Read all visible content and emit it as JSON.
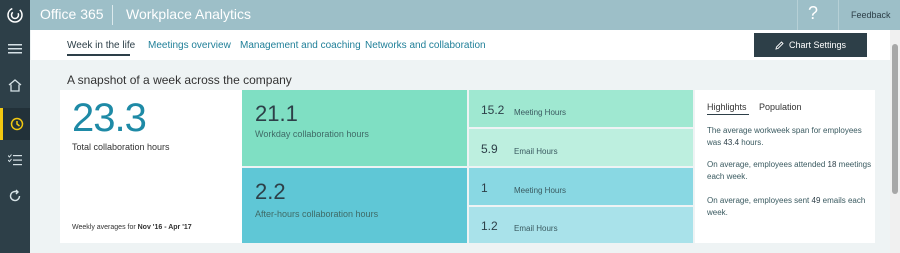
{
  "header": {
    "app_name": "Office 365",
    "product_name": "Workplace Analytics",
    "help_label": "?",
    "feedback_label": "Feedback"
  },
  "rail": {
    "items": [
      {
        "icon": "menu-icon"
      },
      {
        "icon": "home-icon"
      },
      {
        "icon": "clock-icon",
        "active": true
      },
      {
        "icon": "checklist-icon"
      },
      {
        "icon": "refresh-icon"
      }
    ]
  },
  "tabs": [
    {
      "label": "Week in the life",
      "active": true
    },
    {
      "label": "Meetings overview"
    },
    {
      "label": "Management and coaching"
    },
    {
      "label": "Networks and collaboration"
    }
  ],
  "chart_settings_label": "Chart Settings",
  "section_title": "A snapshot of a week across the company",
  "summary": {
    "total_value": "23.3",
    "total_label": "Total collaboration hours",
    "weekly_prefix": "Weekly averages for ",
    "weekly_range": "Nov '16 - Apr '17"
  },
  "workday": {
    "value": "21.1",
    "label": "Workday collaboration hours",
    "meeting_value": "15.2",
    "meeting_label": "Meeting Hours",
    "email_value": "5.9",
    "email_label": "Email Hours"
  },
  "afterhours": {
    "value": "2.2",
    "label": "After-hours collaboration hours",
    "meeting_value": "1",
    "meeting_label": "Meeting Hours",
    "email_value": "1.2",
    "email_label": "Email Hours"
  },
  "highlights": {
    "tab_highlights": "Highlights",
    "tab_population": "Population",
    "items": [
      {
        "pre": "The average workweek span for employees was ",
        "value": "43.4",
        "post": " hours."
      },
      {
        "pre": "On average, employees attended ",
        "value": "18",
        "post": " meetings each week."
      },
      {
        "pre": "On average, employees sent ",
        "value": "49",
        "post": " emails each week."
      }
    ]
  },
  "colors": {
    "workday_main": "#7fdfc3",
    "workday_meeting": "#9fe8d1",
    "workday_email": "#bdefdf",
    "after_main": "#5fc7d6",
    "after_meeting": "#89d8e3",
    "after_email": "#a9e2ea",
    "accent": "#f2c811",
    "dark": "#2d3f48"
  }
}
